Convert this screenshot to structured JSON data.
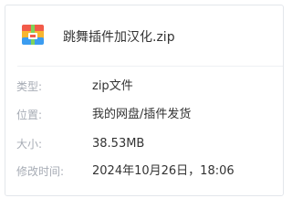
{
  "file": {
    "name": "跳舞插件加汉化.zip",
    "icon": "zip-archive-icon"
  },
  "details": [
    {
      "label": "类型:",
      "value": "zip文件"
    },
    {
      "label": "位置:",
      "value": "我的网盘/插件发货"
    },
    {
      "label": "大小:",
      "value": "38.53MB"
    },
    {
      "label": "修改时间:",
      "value": "2024年10月26日，18:06"
    }
  ],
  "colors": {
    "label": "#a7acb5",
    "value": "#333333",
    "border": "#e3e6eb"
  }
}
